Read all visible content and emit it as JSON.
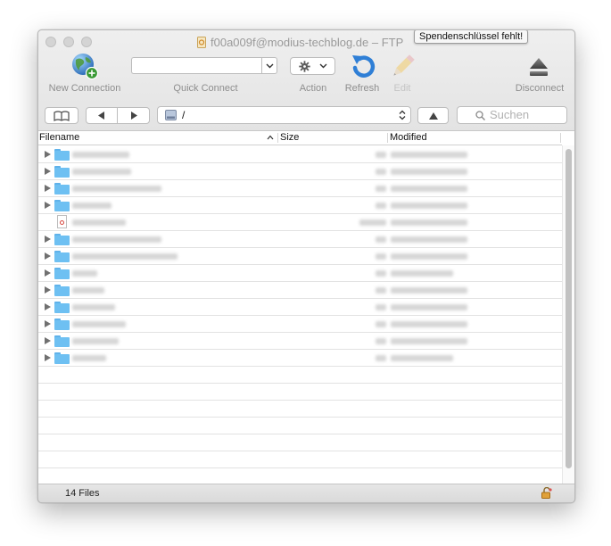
{
  "window": {
    "title": "f00a009f@modius-techblog.de – FTP",
    "tooltip": "Spendenschlüssel fehlt!"
  },
  "toolbar": {
    "new_connection_label": "New Connection",
    "quick_connect_label": "Quick Connect",
    "quick_connect_value": "",
    "action_label": "Action",
    "refresh_label": "Refresh",
    "edit_label": "Edit",
    "disconnect_label": "Disconnect"
  },
  "navigation": {
    "path": "/",
    "search_placeholder": "Suchen"
  },
  "table": {
    "columns": [
      "Filename",
      "Size",
      "Modified"
    ],
    "sort_column": "Filename",
    "rows": [
      {
        "kind": "folder"
      },
      {
        "kind": "folder"
      },
      {
        "kind": "folder"
      },
      {
        "kind": "folder"
      },
      {
        "kind": "file"
      },
      {
        "kind": "folder"
      },
      {
        "kind": "folder"
      },
      {
        "kind": "folder"
      },
      {
        "kind": "folder"
      },
      {
        "kind": "folder"
      },
      {
        "kind": "folder"
      },
      {
        "kind": "folder"
      },
      {
        "kind": "folder"
      }
    ],
    "empty_rows": 7,
    "note_contents": "file names, sizes and dates are blurred in the original"
  },
  "status": {
    "file_count": "14 Files"
  },
  "colors": {
    "folder": "#6ec0f2",
    "refresh_blue": "#2f7fd6",
    "window_bg": "#ececec"
  }
}
